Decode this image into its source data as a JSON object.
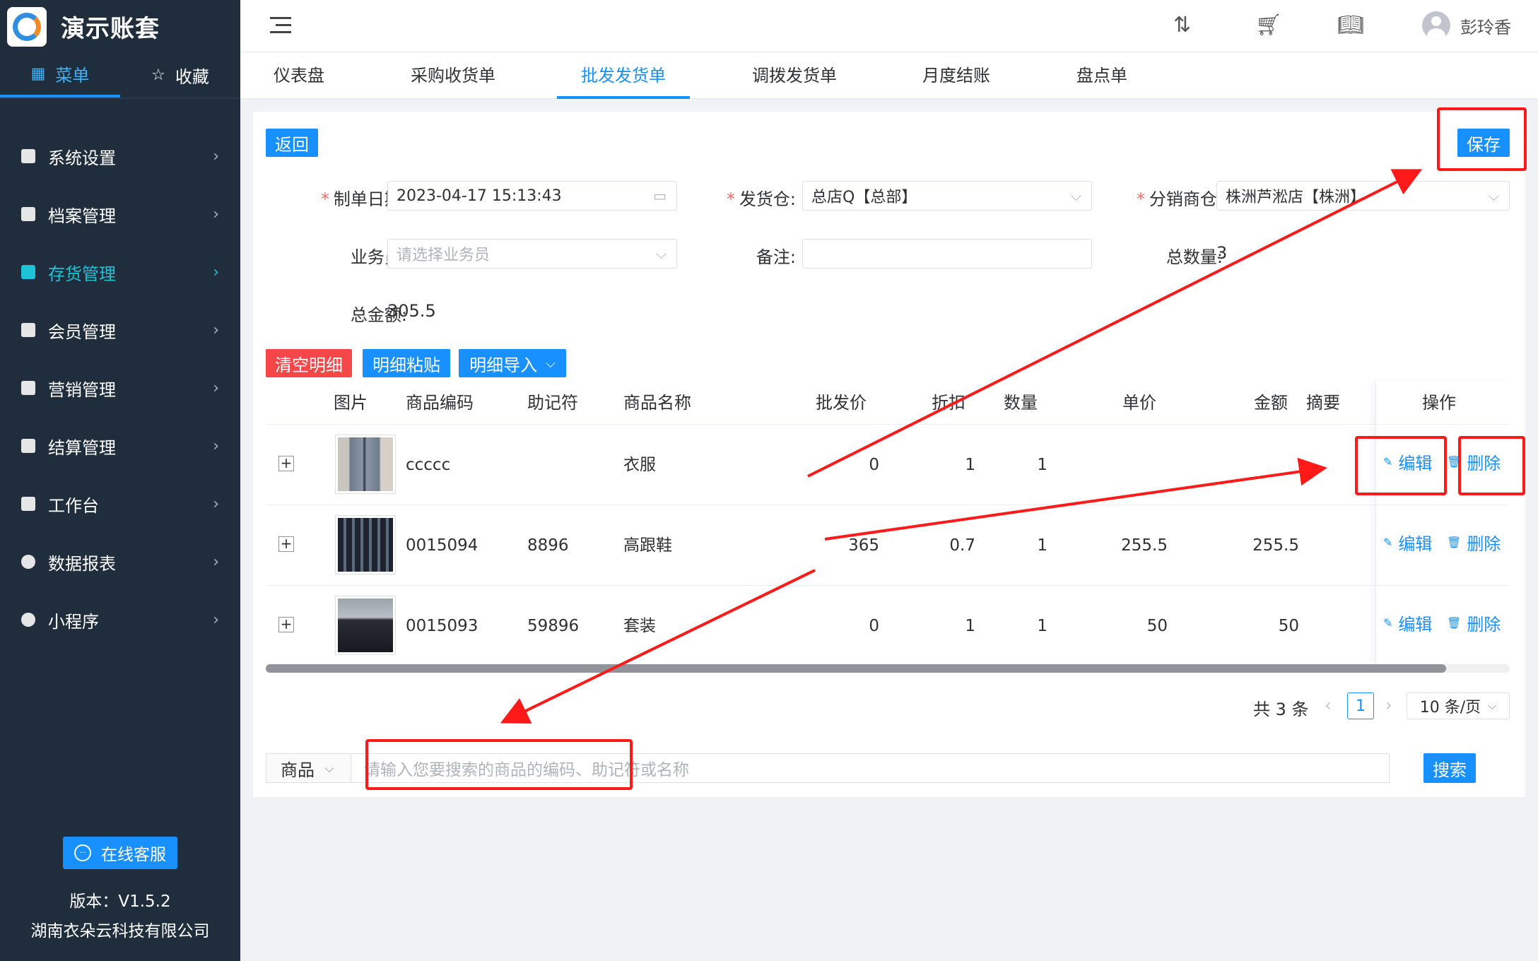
{
  "sidebar": {
    "brand": "演示账套",
    "tabs": {
      "menu": "菜单",
      "favorites": "收藏"
    },
    "items": [
      {
        "label": "系统设置"
      },
      {
        "label": "档案管理"
      },
      {
        "label": "存货管理"
      },
      {
        "label": "会员管理"
      },
      {
        "label": "营销管理"
      },
      {
        "label": "结算管理"
      },
      {
        "label": "工作台"
      },
      {
        "label": "数据报表"
      },
      {
        "label": "小程序"
      }
    ],
    "service_label": "在线客服",
    "version": "版本：V1.5.2",
    "company": "湖南衣朵云科技有限公司"
  },
  "header": {
    "user_name": "彭玲香",
    "icons": [
      "sort-az-icon",
      "cart-icon",
      "book-icon"
    ]
  },
  "nav": {
    "tabs": [
      "仪表盘",
      "采购收货单",
      "批发发货单",
      "调拨发货单",
      "月度结账",
      "盘点单"
    ],
    "active": "批发发货单"
  },
  "form": {
    "back_label": "返回",
    "save_label": "保存",
    "date_label": "制单日期:",
    "date_value": "2023-04-17 15:13:43",
    "warehouse_label": "发货仓:",
    "warehouse_value": "总店Q【总部】",
    "distributor_label": "分销商仓:",
    "distributor_value": "株洲芦淞店【株洲】",
    "salesman_label": "业务员:",
    "salesman_placeholder": "请选择业务员",
    "remark_label": "备注:",
    "remark_value": "",
    "total_qty_label": "总数量:",
    "total_qty_value": "3",
    "total_amount_label": "总金额:",
    "total_amount_value": "305.5"
  },
  "toolbar": {
    "clear_label": "清空明细",
    "paste_label": "明细粘贴",
    "import_label": "明细导入"
  },
  "table": {
    "columns": [
      "图片",
      "商品编码",
      "助记符",
      "商品名称",
      "批发价",
      "折扣",
      "数量",
      "单价",
      "金额",
      "摘要",
      "操作"
    ],
    "rows": [
      {
        "code": "ccccc",
        "mnemonic": "",
        "name": "衣服",
        "price": "0",
        "discount": "1",
        "qty": "1",
        "unit_price": "",
        "amount": "",
        "memo": ""
      },
      {
        "code": "0015094",
        "mnemonic": "8896",
        "name": "高跟鞋",
        "price": "365",
        "discount": "0.7",
        "qty": "1",
        "unit_price": "255.5",
        "amount": "255.5",
        "memo": ""
      },
      {
        "code": "0015093",
        "mnemonic": "59896",
        "name": "套装",
        "price": "0",
        "discount": "1",
        "qty": "1",
        "unit_price": "50",
        "amount": "50",
        "memo": ""
      }
    ],
    "edit_label": "编辑",
    "delete_label": "删除"
  },
  "pagination": {
    "total": "共 3 条",
    "current_page": "1",
    "page_size": "10 条/页"
  },
  "search": {
    "type_label": "商品",
    "placeholder": "请输入您要搜索的商品的编码、助记符或名称",
    "button_label": "搜索"
  },
  "colors": {
    "primary": "#1890ff",
    "danger": "#f5474a",
    "sidebar_bg": "#1f2d3d",
    "sidebar_active": "#1ec3d8",
    "annotation": "#ff1a1a"
  }
}
